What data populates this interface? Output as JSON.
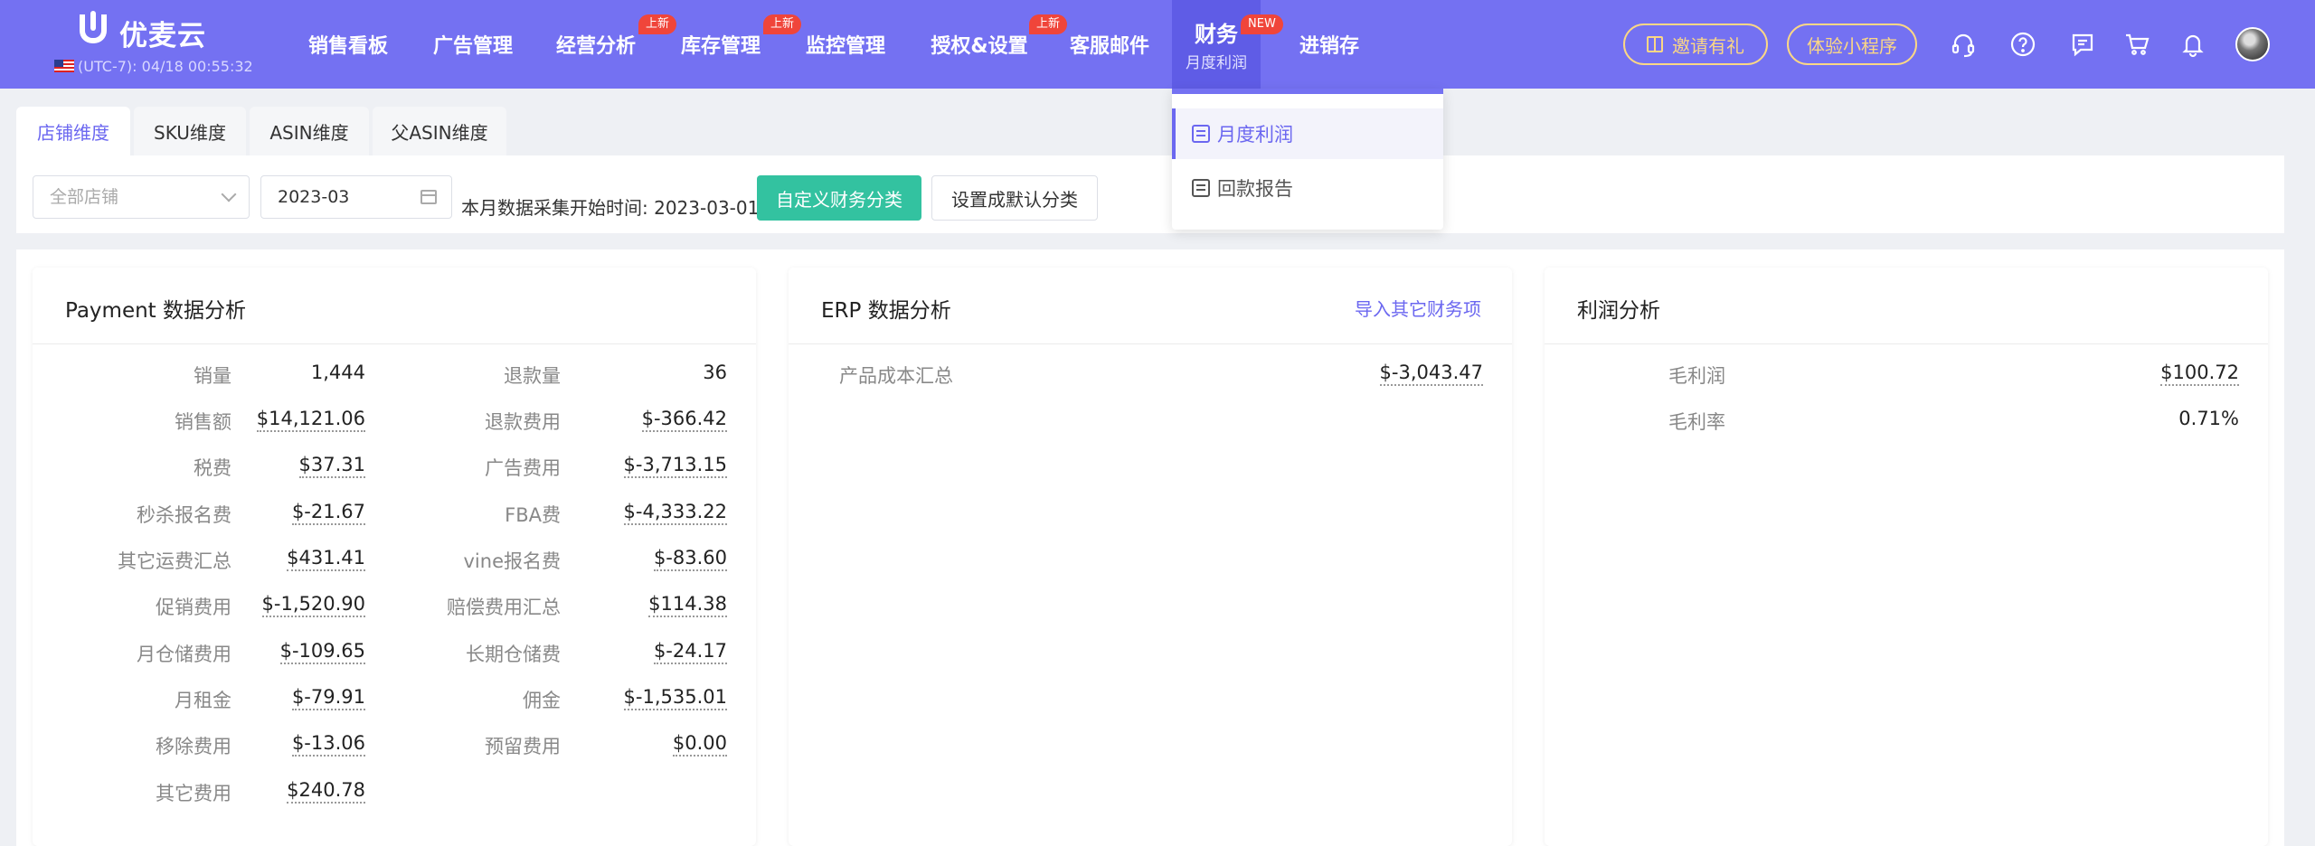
{
  "header": {
    "brand": "优麦云",
    "timezone": "(UTC-7): 04/18 00:55:32",
    "nav": [
      {
        "label": "销售看板",
        "badge": ""
      },
      {
        "label": "广告管理",
        "badge": ""
      },
      {
        "label": "经营分析",
        "badge": "上新"
      },
      {
        "label": "库存管理",
        "badge": "上新"
      },
      {
        "label": "监控管理",
        "badge": ""
      },
      {
        "label": "授权&设置",
        "badge": "上新"
      },
      {
        "label": "客服邮件",
        "badge": ""
      },
      {
        "label": "财务",
        "badge": "NEW",
        "sub": "月度利润",
        "active": true
      },
      {
        "label": "进销存",
        "badge": ""
      }
    ],
    "invite_label": "邀请有礼",
    "miniapp_label": "体验小程序",
    "icons": [
      "headset-icon",
      "help-icon",
      "message-icon",
      "cart-icon",
      "bell-icon"
    ]
  },
  "tabs": [
    {
      "label": "店铺维度",
      "active": true
    },
    {
      "label": "SKU维度"
    },
    {
      "label": "ASIN维度"
    },
    {
      "label": "父ASIN维度"
    }
  ],
  "filters": {
    "store_placeholder": "全部店铺",
    "month": "2023-03",
    "collect_label": "本月数据采集开始时间:",
    "collect_date": "2023-03-01",
    "custom_category_label": "自定义财务分类",
    "set_default_label": "设置成默认分类"
  },
  "finance_menu": [
    {
      "label": "月度利润",
      "active": true
    },
    {
      "label": "回款报告"
    }
  ],
  "payment": {
    "title": "Payment 数据分析",
    "left": [
      {
        "label": "销量",
        "value": "1,444",
        "dotted": false
      },
      {
        "label": "销售额",
        "value": "$14,121.06",
        "dotted": true
      },
      {
        "label": "税费",
        "value": "$37.31",
        "dotted": true
      },
      {
        "label": "秒杀报名费",
        "value": "$-21.67",
        "dotted": true
      },
      {
        "label": "其它运费汇总",
        "value": "$431.41",
        "dotted": true
      },
      {
        "label": "促销费用",
        "value": "$-1,520.90",
        "dotted": true
      },
      {
        "label": "月仓储费用",
        "value": "$-109.65",
        "dotted": true
      },
      {
        "label": "月租金",
        "value": "$-79.91",
        "dotted": true
      },
      {
        "label": "移除费用",
        "value": "$-13.06",
        "dotted": true
      },
      {
        "label": "其它费用",
        "value": "$240.78",
        "dotted": true
      }
    ],
    "right": [
      {
        "label": "退款量",
        "value": "36",
        "dotted": false
      },
      {
        "label": "退款费用",
        "value": "$-366.42",
        "dotted": true
      },
      {
        "label": "广告费用",
        "value": "$-3,713.15",
        "dotted": true
      },
      {
        "label": "FBA费",
        "value": "$-4,333.22",
        "dotted": true
      },
      {
        "label": "vine报名费",
        "value": "$-83.60",
        "dotted": true
      },
      {
        "label": "赔偿费用汇总",
        "value": "$114.38",
        "dotted": true
      },
      {
        "label": "长期仓储费",
        "value": "$-24.17",
        "dotted": true
      },
      {
        "label": "佣金",
        "value": "$-1,535.01",
        "dotted": true
      },
      {
        "label": "预留费用",
        "value": "$0.00",
        "dotted": true
      }
    ]
  },
  "erp": {
    "title": "ERP 数据分析",
    "import_label": "导入其它财务项",
    "rows": [
      {
        "label": "产品成本汇总",
        "value": "$-3,043.47",
        "dotted": true
      }
    ]
  },
  "profit": {
    "title": "利润分析",
    "rows": [
      {
        "label": "毛利润",
        "value": "$100.72",
        "dotted": true
      },
      {
        "label": "毛利率",
        "value": "0.71%",
        "dotted": false
      }
    ]
  },
  "colors": {
    "header_bg": "#7471f2",
    "active_nav_bg": "#5f5ce6",
    "accent": "#6b67f0",
    "primary_button": "#33c2a0",
    "badge": "#f0453a",
    "pill_gold": "#fbd785"
  }
}
